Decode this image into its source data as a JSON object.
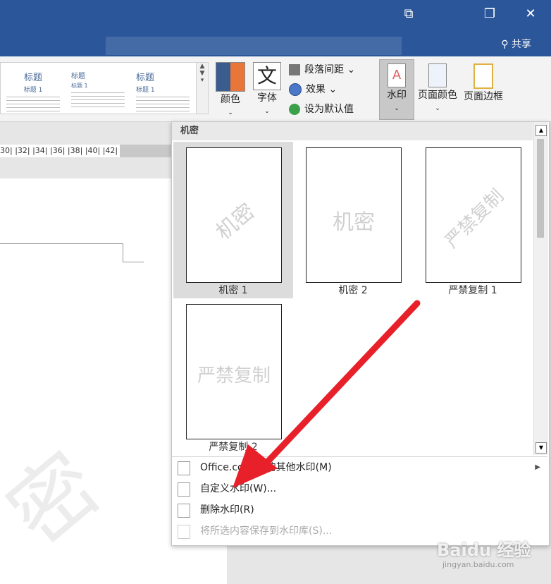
{
  "titlebar": {
    "share_label": "共享",
    "icons": [
      "ribbon-display-icon",
      "restore-icon",
      "close-icon"
    ]
  },
  "gallery": {
    "items": [
      {
        "title": "标题",
        "sub": "标题 1"
      },
      {
        "title": "标题",
        "sub": "标题 1"
      },
      {
        "title": "标题",
        "sub": "标题 1"
      }
    ]
  },
  "ribbon": {
    "colors_label": "颜色",
    "fonts_label": "字体",
    "fonts_icon_char": "文",
    "paragraph_spacing_label": "段落间距",
    "effects_label": "效果",
    "set_default_label": "设为默认值",
    "watermark_label": "水印",
    "page_color_label": "页面颜色",
    "page_border_label": "页面边框"
  },
  "ruler": {
    "ticks": "30|  |32|  |34|  |36|  |38|  |40|  |42|  |4"
  },
  "panel": {
    "category": "机密",
    "thumbnails": [
      {
        "label": "机密 1",
        "wm": "机密",
        "selected": true
      },
      {
        "label": "机密 2",
        "wm": "机密",
        "selected": false
      },
      {
        "label": "严禁复制 1",
        "wm": "严禁复制",
        "selected": false
      },
      {
        "label": "严禁复制 2",
        "wm": "严禁复制",
        "selected": false
      }
    ],
    "menu": [
      {
        "label": "Office.com 中的其他水印(M)",
        "icon": "globe-watermark-icon",
        "disabled": false,
        "submenu": true
      },
      {
        "label": "自定义水印(W)...",
        "icon": "custom-watermark-icon",
        "disabled": false,
        "submenu": false
      },
      {
        "label": "删除水印(R)",
        "icon": "remove-watermark-icon",
        "disabled": false,
        "submenu": false
      },
      {
        "label": "将所选内容保存到水印库(S)...",
        "icon": "save-watermark-icon",
        "disabled": true,
        "submenu": false
      }
    ]
  },
  "watermark_overlay": {
    "baidu": "Baidu 经验",
    "url": "jingyan.baidu.com"
  },
  "colors": {
    "titlebar": "#2b579a",
    "arrow": "#e8202a"
  }
}
